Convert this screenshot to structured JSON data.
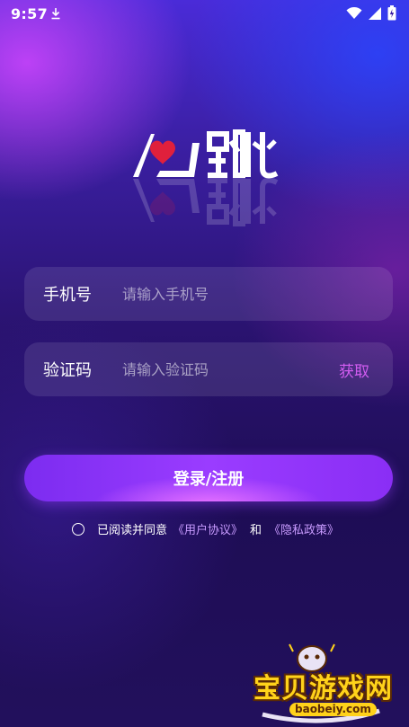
{
  "status_bar": {
    "time": "9:57"
  },
  "app": {
    "logo_text": "心跳"
  },
  "phone_field": {
    "label": "手机号",
    "placeholder": "请输入手机号",
    "value": ""
  },
  "code_field": {
    "label": "验证码",
    "placeholder": "请输入验证码",
    "value": "",
    "action_label": "获取"
  },
  "login_button": {
    "label": "登录/注册"
  },
  "agreement": {
    "checked": false,
    "prefix": "已阅读并同意",
    "user_agreement": "《用户协议》",
    "conjunction": "和",
    "privacy_policy": "《隐私政策》"
  },
  "watermark": {
    "title": "宝贝游戏网",
    "url": "baobeiy.com"
  },
  "colors": {
    "accent": "#9a3cff",
    "link": "#c89bff",
    "action": "#d15cf0",
    "heart": "#e0203c"
  }
}
